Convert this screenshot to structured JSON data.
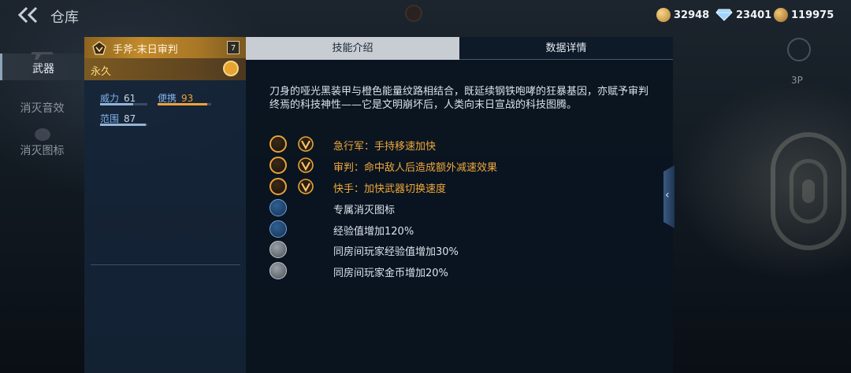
{
  "topbar": {
    "title": "仓库",
    "currencies": [
      {
        "icon": "gold-coin-icon",
        "value": "32948"
      },
      {
        "icon": "diamond-icon",
        "value": "23401"
      },
      {
        "icon": "medal-coin-icon",
        "value": "119975"
      }
    ]
  },
  "nav": {
    "items": [
      {
        "label": "武器",
        "active": true
      },
      {
        "label": "消灭音效",
        "active": false
      },
      {
        "label": "消灭图标",
        "active": false
      }
    ]
  },
  "weapon": {
    "name": "手斧-末日审判",
    "level": "7",
    "duration": "永久",
    "stats": [
      {
        "label": "威力",
        "value": "61"
      },
      {
        "label": "便携",
        "value": "93"
      },
      {
        "label": "范围",
        "value": "87"
      }
    ]
  },
  "tabs": {
    "skill": "技能介绍",
    "data": "数据详情"
  },
  "description": "刀身的哑光黑装甲与橙色能量纹路相结合，既延续钢铁咆哮的狂暴基因，亦赋予审判终焉的科技神性——它是文明崩坏后，人类向末日宣战的科技图腾。",
  "features": [
    {
      "icon": "running-man-icon",
      "text": "急行军：手持移速加快",
      "vip": true
    },
    {
      "icon": "judgement-icon",
      "text": "审判：命中敌人后造成额外减速效果",
      "vip": true
    },
    {
      "icon": "quick-hand-icon",
      "text": "快手：加快武器切换速度",
      "vip": true
    },
    {
      "icon": "kill-icon-badge",
      "text": "专属消灭图标",
      "vip": false
    },
    {
      "icon": "exp-plus-icon",
      "text": "经验值增加120%",
      "vip": false
    },
    {
      "icon": "room-exp-icon",
      "text": "同房间玩家经验值增加30%",
      "vip": false
    },
    {
      "icon": "room-gold-icon",
      "text": "同房间玩家金币增加20%",
      "vip": false
    }
  ],
  "side": {
    "mode_label": "3P"
  },
  "colors": {
    "gold": "#f0a83a",
    "tab_active": "#c7cdd3",
    "panel": "#14243a"
  }
}
